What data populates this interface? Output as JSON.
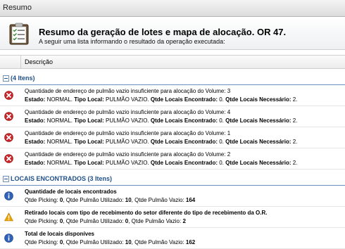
{
  "window": {
    "title": "Resumo"
  },
  "header": {
    "title": "Resumo da geração de lotes e mapa de alocação. OR 47.",
    "subtitle": "A seguir uma lista informando o resultado da operação executada:"
  },
  "table": {
    "column_header": "Descrição"
  },
  "group1": {
    "label": "(4 Itens)",
    "items": [
      {
        "text": "Quantidade de endereço de pulmão vazio insuficiente para alocação do Volume: 3",
        "estado_label": "Estado:",
        "estado": " NORMAL. ",
        "tipo_label": "Tipo Local:",
        "tipo": " PULMÃO VAZIO. ",
        "enc_label": "Qtde Locais Encontrado:",
        "enc": " 0. ",
        "nec_label": "Qtde Locais Necessário:",
        "nec": " 2."
      },
      {
        "text": "Quantidade de endereço de pulmão vazio insuficiente para alocação do Volume: 4",
        "estado_label": "Estado:",
        "estado": " NORMAL. ",
        "tipo_label": "Tipo Local:",
        "tipo": " PULMÃO VAZIO. ",
        "enc_label": "Qtde Locais Encontrado:",
        "enc": " 0. ",
        "nec_label": "Qtde Locais Necessário:",
        "nec": " 2."
      },
      {
        "text": "Quantidade de endereço de pulmão vazio insuficiente para alocação do Volume: 1",
        "estado_label": "Estado:",
        "estado": " NORMAL. ",
        "tipo_label": "Tipo Local:",
        "tipo": " PULMÃO VAZIO. ",
        "enc_label": "Qtde Locais Encontrado:",
        "enc": " 0. ",
        "nec_label": "Qtde Locais Necessário:",
        "nec": " 2."
      },
      {
        "text": "Quantidade de endereço de pulmão vazio insuficiente para alocação do Volume: 2",
        "estado_label": "Estado:",
        "estado": " NORMAL. ",
        "tipo_label": "Tipo Local:",
        "tipo": " PULMÃO VAZIO. ",
        "enc_label": "Qtde Locais Encontrado:",
        "enc": " 0. ",
        "nec_label": "Qtde Locais Necessário:",
        "nec": " 2."
      }
    ]
  },
  "group2": {
    "label": "LOCAIS ENCONTRADOS (3 Itens)",
    "items": [
      {
        "icon": "info-icon",
        "title": "Quantidade de locais encontrados",
        "p1": "Qtde Picking: ",
        "v1": "0",
        "p2": ", Qtde Pulmão Utilizado: ",
        "v2": "10",
        "p3": ", Qtde Pulmão Vazio: ",
        "v3": "164"
      },
      {
        "icon": "warning-icon",
        "title": "Retirado locais com tipo de recebimento do setor diferente do tipo de recebimento da O.R.",
        "p1": "Qtde Picking: ",
        "v1": "0",
        "p2": ", Qtde Pulmão Utilizado: ",
        "v2": "0",
        "p3": ", Qtde Pulmão Vazio: ",
        "v3": "2"
      },
      {
        "icon": "info-icon",
        "title": "Total de locais disponíves",
        "p1": "Qtde Picking: ",
        "v1": "0",
        "p2": ", Qtde Pulmão Utilizado: ",
        "v2": "10",
        "p3": ", Qtde Pulmão Vazio: ",
        "v3": "162"
      }
    ]
  },
  "colors": {
    "error": "#c8262b",
    "info": "#2f62b8",
    "warning": "#f0a400",
    "group_text": "#1f4f8a"
  }
}
